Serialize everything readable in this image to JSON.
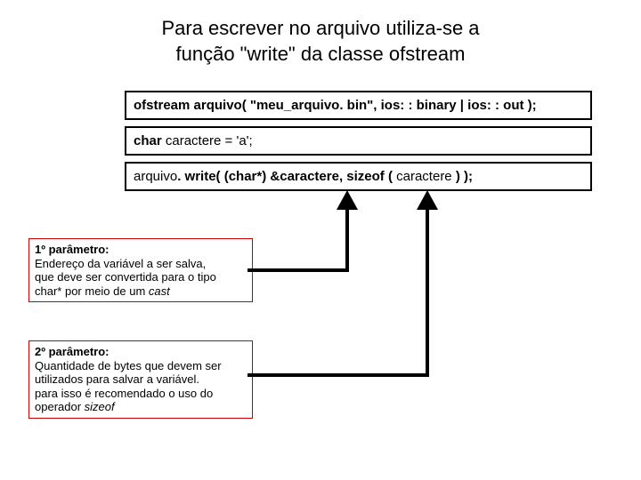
{
  "title_line1": "Para escrever no arquivo utiliza-se a",
  "title_line2": "função \"write\" da classe ofstream",
  "code": {
    "line1_a": "ofstream arquivo( \"meu_arquivo. bin\", ios: : binary | ios: : out );",
    "line2_a": "char ",
    "line2_b": "caractere = 'a';",
    "line3_a": "arquivo",
    "line3_b": ". write( (char*) &caractere, sizeof ( ",
    "line3_c": "caractere",
    "line3_d": " ) );"
  },
  "note1": {
    "heading": "1º parâmetro:",
    "l1": "Endereço da variável a ser salva,",
    "l2": "que deve ser convertida para o tipo",
    "l3_a": "char* por meio de um ",
    "l3_b": "cast"
  },
  "note2": {
    "heading": "2º parâmetro:",
    "l1": "Quantidade de bytes que devem ser",
    "l2": "utilizados para salvar a variável.",
    "l3": "para isso é recomendado o uso do",
    "l4_a": "operador ",
    "l4_b": "sizeof"
  }
}
